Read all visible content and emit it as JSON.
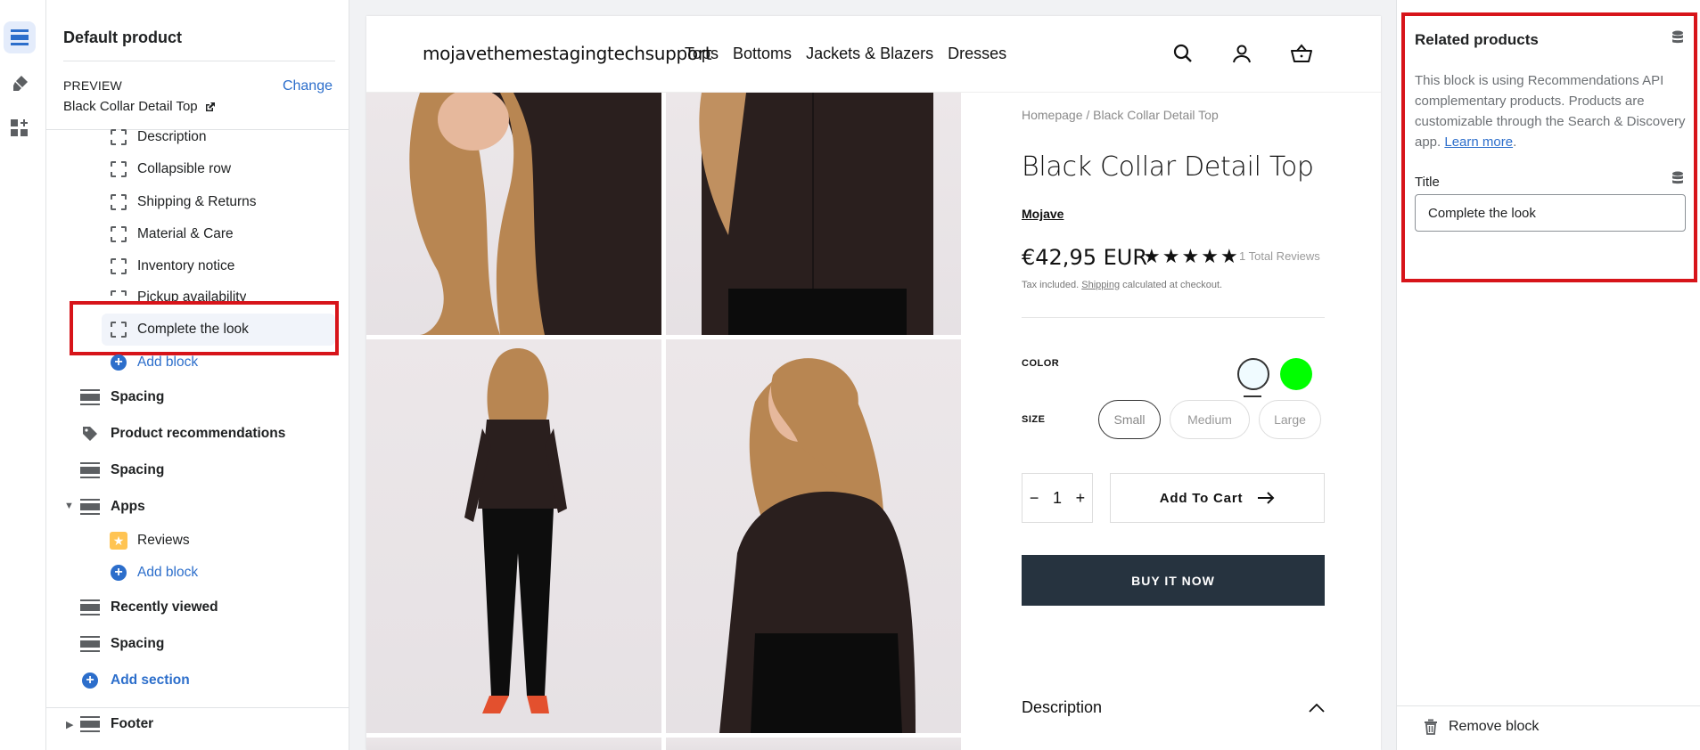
{
  "left_panel": {
    "title": "Default product",
    "preview_label": "PREVIEW",
    "change_label": "Change",
    "preview_product": "Black Collar Detail Top",
    "blocks": [
      {
        "label": "Description",
        "icon": "dashed-block-icon"
      },
      {
        "label": "Collapsible row",
        "icon": "dashed-block-icon"
      },
      {
        "label": "Shipping & Returns",
        "icon": "dashed-block-icon"
      },
      {
        "label": "Material & Care",
        "icon": "dashed-block-icon"
      },
      {
        "label": "Inventory notice",
        "icon": "dashed-block-icon"
      },
      {
        "label": "Pickup availability",
        "icon": "dashed-block-icon"
      },
      {
        "label": "Complete the look",
        "icon": "dashed-block-icon",
        "selected": true
      }
    ],
    "add_block_label": "Add block",
    "sections": [
      {
        "label": "Spacing",
        "icon": "section-icon"
      },
      {
        "label": "Product recommendations",
        "icon": "tag-icon"
      },
      {
        "label": "Spacing",
        "icon": "section-icon"
      },
      {
        "label": "Apps",
        "icon": "section-icon",
        "expanded": true
      }
    ],
    "apps_blocks": [
      {
        "label": "Reviews",
        "icon": "star-icon"
      },
      {
        "label": "Add block",
        "icon": "plus-icon"
      }
    ],
    "sections_after": [
      {
        "label": "Recently viewed",
        "icon": "section-icon"
      },
      {
        "label": "Spacing",
        "icon": "section-icon"
      }
    ],
    "add_section_label": "Add section",
    "footer_label": "Footer"
  },
  "store": {
    "logo": "mojavethemestagingtechsupport",
    "nav": [
      "Tops",
      "Bottoms",
      "Jackets & Blazers",
      "Dresses"
    ],
    "header_icons": [
      "search-icon",
      "account-icon",
      "cart-icon"
    ],
    "breadcrumb": [
      "Homepage",
      "/",
      "Black Collar Detail Top"
    ],
    "product_title": "Black Collar Detail Top",
    "vendor": "Mojave",
    "price": "€42,95 EUR",
    "rating_stars": 5,
    "reviews_text": "1 Total Reviews",
    "tax_prefix": "Tax included.",
    "tax_link": "Shipping",
    "tax_suffix": "calculated at checkout.",
    "color_label": "COLOR",
    "colors": [
      "#f0fbff",
      "#00ff00"
    ],
    "size_label": "SIZE",
    "sizes": [
      "Small",
      "Medium",
      "Large"
    ],
    "quantity": "1",
    "qty_minus": "−",
    "qty_plus": "+",
    "add_to_cart": "Add To Cart",
    "buy_now": "BUY IT NOW",
    "description_label": "Description"
  },
  "right_panel": {
    "title": "Related products",
    "desc_text": "This block is using Recommendations API complementary products. Products are customizable through the Search & Discovery app.",
    "learn_more": "Learn more",
    "desc_end": ".",
    "field_label": "Title",
    "field_value": "Complete the look",
    "remove_label": "Remove block"
  },
  "colors": {
    "accent": "#2c6ecb",
    "highlight_red": "#d7141a",
    "buy_button": "#26333f"
  }
}
